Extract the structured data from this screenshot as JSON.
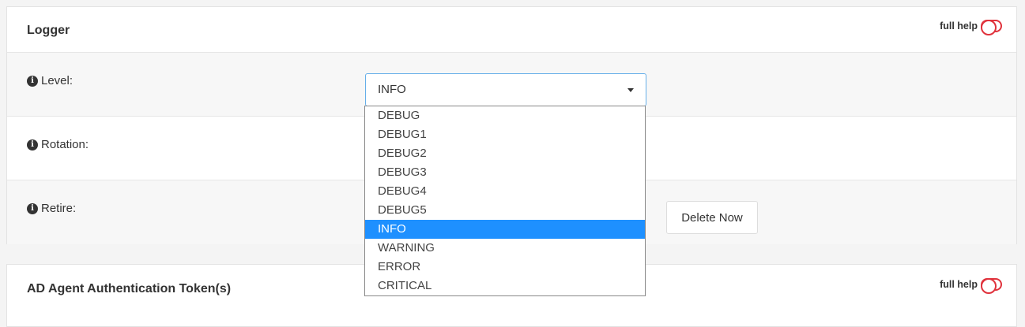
{
  "logger": {
    "title": "Logger",
    "full_help": "full help",
    "rows": [
      {
        "label": "Level:"
      },
      {
        "label": "Rotation:"
      },
      {
        "label": "Retire:"
      }
    ],
    "level_select": {
      "value": "INFO",
      "options": [
        "DEBUG",
        "DEBUG1",
        "DEBUG2",
        "DEBUG3",
        "DEBUG4",
        "DEBUG5",
        "INFO",
        "WARNING",
        "ERROR",
        "CRITICAL"
      ],
      "selected_index": 6
    },
    "delete_button": "Delete Now"
  },
  "ad_panel": {
    "title": "AD Agent Authentication Token(s)",
    "full_help": "full help"
  },
  "colors": {
    "toggle": "#e0323c",
    "selected_option": "#1e90ff",
    "select_focus_border": "#66afe9"
  }
}
